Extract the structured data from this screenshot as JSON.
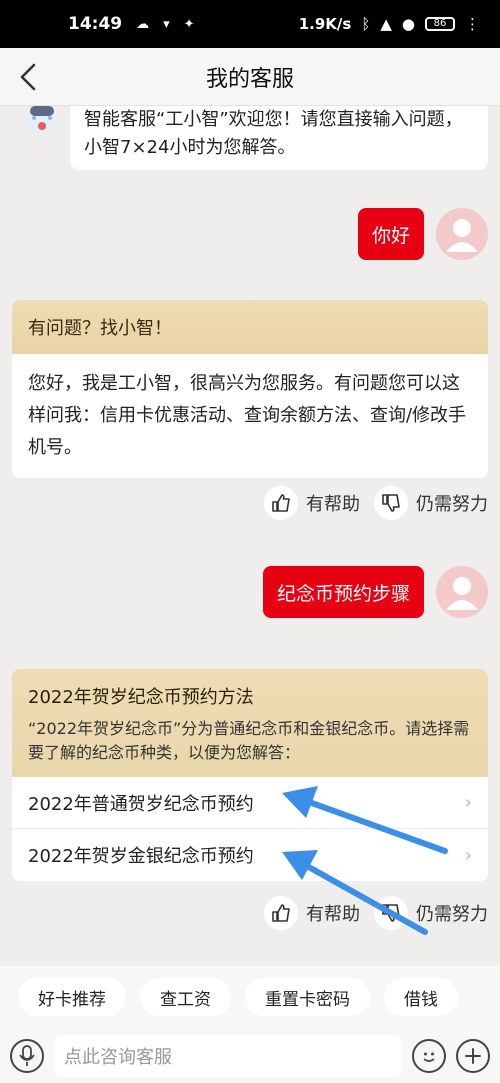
{
  "status_bar": {
    "time": "14:49",
    "network_speed": "1.9K/s",
    "battery": "86"
  },
  "header": {
    "title": "我的客服"
  },
  "chat": {
    "welcome_text": "智能客服“工小智”欢迎您！请您直接输入问题，小智7×24小时为您解答。",
    "user_msg_1": "你好",
    "card1": {
      "title": "有问题？找小智！",
      "body": "您好，我是工小智，很高兴为您服务。有问题您可以这样问我：信用卡优惠活动、查询余额方法、查询/修改手机号。"
    },
    "feedback": {
      "helpful": "有帮助",
      "needs_work": "仍需努力"
    },
    "user_msg_2": "纪念币预约步骤",
    "card2": {
      "title": "2022年贺岁纪念币预约方法",
      "desc": "“2022年贺岁纪念币”分为普通纪念币和金银纪念币。请选择需要了解的纪念币种类，以便为您解答：",
      "options": [
        "2022年普通贺岁纪念币预约",
        "2022年贺岁金银纪念币预约"
      ]
    }
  },
  "quick_actions": [
    "好卡推荐",
    "查工资",
    "重置卡密码",
    "借钱"
  ],
  "input": {
    "placeholder": "点此咨询客服"
  },
  "colors": {
    "accent": "#e60012",
    "card_header": "#ecd9b0",
    "arrow": "#3b8fe6"
  }
}
